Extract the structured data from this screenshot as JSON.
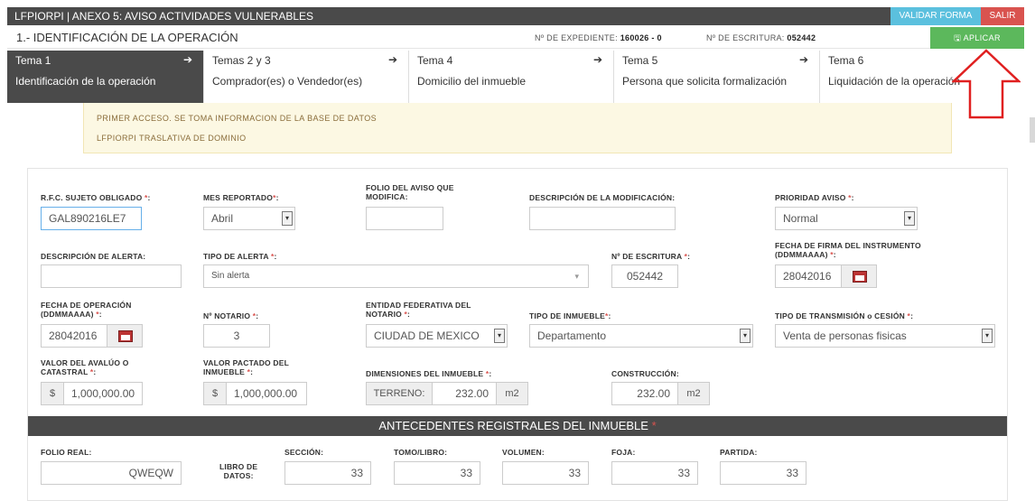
{
  "topbar": {
    "title": "LFPIORPI | ANEXO 5: AVISO ACTIVIDADES VULNERABLES",
    "validar_label": "VALIDAR FORMA",
    "salir_label": "SALIR"
  },
  "section": {
    "title": "1.- IDENTIFICACIÓN DE LA OPERACIÓN",
    "expediente_label": "Nº DE EXPEDIENTE:",
    "expediente_value": "160026 - 0",
    "escritura_label": "Nº DE ESCRITURA:",
    "escritura_value": "052442",
    "aplicar_label": "🖫 APLICAR"
  },
  "tabs": [
    {
      "num": "Tema 1",
      "desc": "Identificación de la operación",
      "arrow": "➔"
    },
    {
      "num": "Temas 2 y 3",
      "desc": "Comprador(es) o Vendedor(es)",
      "arrow": "➔"
    },
    {
      "num": "Tema 4",
      "desc": "Domicilio del inmueble",
      "arrow": "➔"
    },
    {
      "num": "Tema 5",
      "desc": "Persona que solicita formalización",
      "arrow": "➔"
    },
    {
      "num": "Tema 6",
      "desc": "Liquidación de la operación",
      "arrow": ""
    }
  ],
  "notice": {
    "line1": "PRIMER ACCESO. SE TOMA INFORMACION DE LA BASE DE DATOS",
    "line2": "LFPIORPI TRASLATIVA DE DOMINIO"
  },
  "form": {
    "rfc_label": "R.F.C. SUJETO OBLIGADO ",
    "rfc_value": "GAL890216LE7",
    "mes_label": "MES REPORTADO",
    "mes_value": "Abril",
    "folio_label_1": "FOLIO DEL AVISO QUE",
    "folio_label_2": "MODIFICA:",
    "descmod_label": "DESCRIPCIÓN DE LA MODIFICACIÓN:",
    "prioridad_label": "PRIORIDAD AVISO ",
    "prioridad_value": "Normal",
    "descalerta_label": "DESCRIPCIÓN DE ALERTA:",
    "tipoalerta_label": "TIPO DE ALERTA ",
    "tipoalerta_value": "Sin alerta",
    "noescritura_label": "Nº DE ESCRITURA ",
    "noescritura_value": "052442",
    "fechafirma_label_1": "FECHA DE FIRMA DEL INSTRUMENTO",
    "fechafirma_label_2": "(DDMMAAAA) ",
    "fechafirma_value": "28042016",
    "fechaop_label_1": "FECHA DE OPERACIÓN",
    "fechaop_label_2": "(DDMMAAAA) ",
    "fechaop_value": "28042016",
    "notario_label": "Nº NOTARIO ",
    "notario_value": "3",
    "entidad_label_1": "ENTIDAD FEDERATIVA DEL",
    "entidad_label_2": "NOTARIO ",
    "entidad_value": "CIUDAD DE MEXICO",
    "tipoinm_label": "TIPO DE INMUEBLE",
    "tipoinm_value": "Departamento",
    "tipotrans_label": "TIPO DE TRANSMISIÓN o CESIÓN ",
    "tipotrans_value": "Venta de personas fisicas",
    "avaluo_label_1": "VALOR DEL AVALÚO O",
    "avaluo_label_2": "CATASTRAL ",
    "avaluo_value": "1,000,000.00",
    "pactado_label_1": "VALOR PACTADO DEL",
    "pactado_label_2": "INMUEBLE ",
    "pactado_value": "1,000,000.00",
    "currency": "$",
    "dimensiones_label": "DIMENSIONES DEL INMUEBLE ",
    "terreno_label": "TERRENO:",
    "terreno_value": "232.00",
    "unit": "m2",
    "construccion_label": "CONSTRUCCIÓN:",
    "construccion_value": "232.00",
    "required_mark": "*",
    "colon": ":"
  },
  "antecedentes": {
    "title": "ANTECEDENTES REGISTRALES DEL INMUEBLE ",
    "folio_label": "FOLIO REAL:",
    "folio_value": "QWEQW",
    "libro_label_1": "LIBRO DE",
    "libro_label_2": "DATOS:",
    "seccion_label": "SECCIÓN:",
    "seccion_value": "33",
    "tomo_label": "TOMO/LIBRO:",
    "tomo_value": "33",
    "volumen_label": "VOLUMEN:",
    "volumen_value": "33",
    "foja_label": "FOJA:",
    "foja_value": "33",
    "partida_label": "PARTIDA:",
    "partida_value": "33"
  },
  "icons": {
    "select_arrow": "▾",
    "caret": "▾"
  },
  "colors": {
    "dark_bar": "#4a4a4a",
    "validar": "#5bc0de",
    "salir": "#d9534f",
    "aplicar": "#5cb85c",
    "notice_bg": "#fcf8e3",
    "annotation_arrow": "#e02020"
  }
}
